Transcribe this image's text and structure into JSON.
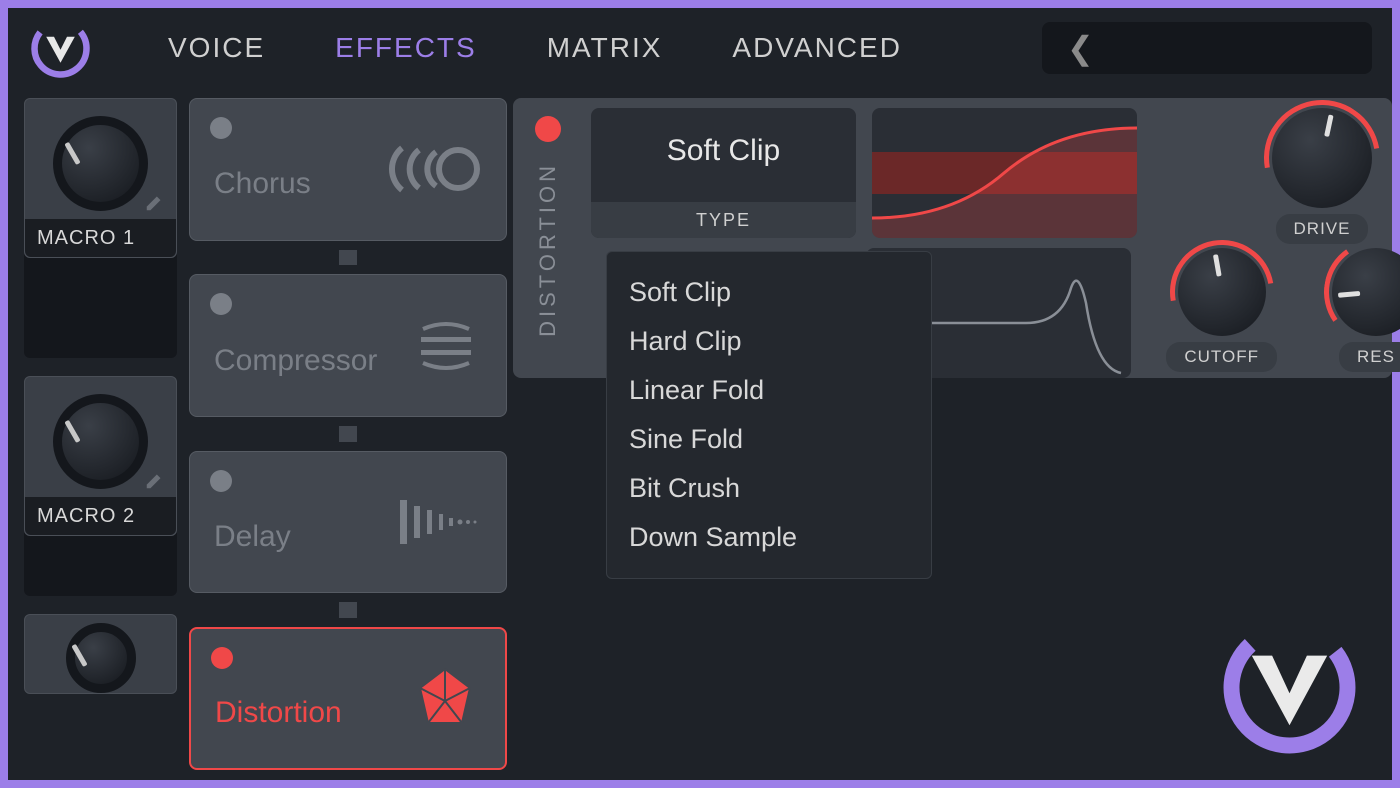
{
  "nav": {
    "voice": "VOICE",
    "effects": "EFFECTS",
    "matrix": "MATRIX",
    "advanced": "ADVANCED"
  },
  "macros": {
    "m1": "MACRO 1",
    "m2": "MACRO 2"
  },
  "effects": {
    "chorus": "Chorus",
    "compressor": "Compressor",
    "delay": "Delay",
    "distortion": "Distortion"
  },
  "detail": {
    "title": "DISTORTION",
    "type_value": "Soft Clip",
    "type_label": "TYPE"
  },
  "knobs": {
    "drive": "DRIVE",
    "cutoff": "CUTOFF",
    "res": "RES"
  },
  "dropdown": [
    "Soft Clip",
    "Hard Clip",
    "Linear Fold",
    "Sine Fold",
    "Bit Crush",
    "Down Sample"
  ]
}
